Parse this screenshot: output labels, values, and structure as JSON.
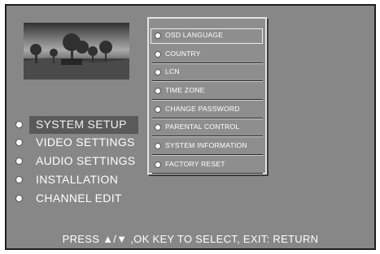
{
  "main_menu": {
    "items": [
      {
        "label": "SYSTEM SETUP",
        "selected": true
      },
      {
        "label": "VIDEO SETTINGS",
        "selected": false
      },
      {
        "label": "AUDIO SETTINGS",
        "selected": false
      },
      {
        "label": "INSTALLATION",
        "selected": false
      },
      {
        "label": "CHANNEL EDIT",
        "selected": false
      }
    ]
  },
  "submenu": {
    "items": [
      {
        "label": "OSD LANGUAGE",
        "focused": true
      },
      {
        "label": "COUNTRY",
        "focused": false
      },
      {
        "label": "LCN",
        "focused": false
      },
      {
        "label": "TIME ZONE",
        "focused": false
      },
      {
        "label": "CHANGE PASSWORD",
        "focused": false
      },
      {
        "label": "PARENTAL CONTROL",
        "focused": false
      },
      {
        "label": "SYSTEM INFORMATION",
        "focused": false
      },
      {
        "label": "FACTORY RESET",
        "focused": false
      }
    ]
  },
  "footer": {
    "hint": "PRESS ▲/▼ ,OK KEY TO SELECT, EXIT: RETURN"
  },
  "colors": {
    "background": "#878787",
    "text": "#ffffff",
    "highlight": "#5a5a5a"
  }
}
